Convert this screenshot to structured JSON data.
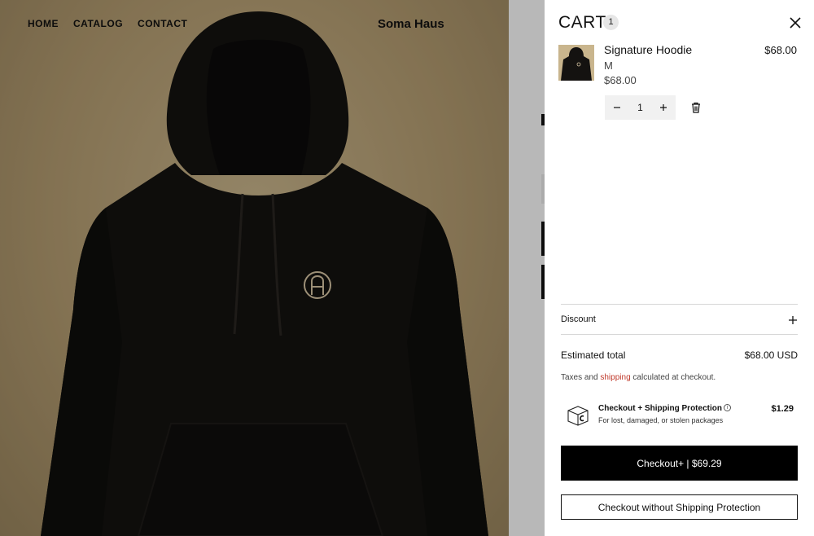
{
  "nav": {
    "home": "HOME",
    "catalog": "CATALOG",
    "contact": "CONTACT"
  },
  "brand": "Soma Haus",
  "cart": {
    "title": "CART",
    "count": "1",
    "item": {
      "name": "Signature Hoodie",
      "variant": "M",
      "unit_price": "$68.00",
      "line_price": "$68.00",
      "quantity": "1"
    },
    "discount_label": "Discount",
    "total_label": "Estimated total",
    "total_value": "$68.00 USD",
    "tax_note_before": "Taxes and ",
    "tax_note_link": "shipping",
    "tax_note_after": " calculated at checkout.",
    "protection": {
      "title": "Checkout + Shipping Protection",
      "subtitle": "For lost, damaged, or stolen packages",
      "price": "$1.29"
    },
    "checkout_plus_label": "Checkout+ | $69.29",
    "checkout_plain_label": "Checkout without Shipping Protection"
  },
  "colors": {
    "accent_link": "#c0392b",
    "primary_button": "#000000",
    "hoodie": "#141210"
  },
  "icons": [
    "close-icon",
    "minus-icon",
    "plus-icon",
    "trash-icon",
    "info-icon",
    "package-icon"
  ]
}
